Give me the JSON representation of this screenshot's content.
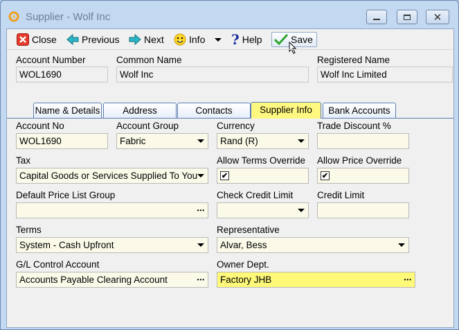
{
  "window": {
    "title": "Supplier - Wolf Inc"
  },
  "toolbar": {
    "close_label": "Close",
    "previous_label": "Previous",
    "next_label": "Next",
    "info_label": "Info",
    "help_label": "Help",
    "save_label": "Save"
  },
  "header": {
    "account_number_label": "Account Number",
    "account_number": "WOL1690",
    "common_name_label": "Common Name",
    "common_name": "Wolf Inc",
    "registered_name_label": "Registered Name",
    "registered_name": "Wolf Inc Limited"
  },
  "tabs": [
    "Name & Details",
    "Address",
    "Contacts",
    "Supplier Info",
    "Bank Accounts"
  ],
  "active_tab": "Supplier Info",
  "form": {
    "account_no_label": "Account No",
    "account_no": "WOL1690",
    "account_group_label": "Account Group",
    "account_group": "Fabric",
    "currency_label": "Currency",
    "currency": "Rand (R)",
    "trade_discount_label": "Trade Discount %",
    "trade_discount": "",
    "tax_label": "Tax",
    "tax": "Capital Goods or Services Supplied To You",
    "allow_terms_override_label": "Allow Terms Override",
    "allow_terms_override": true,
    "allow_price_override_label": "Allow Price Override",
    "allow_price_override": true,
    "default_price_list_group_label": "Default Price List Group",
    "default_price_list_group": "",
    "check_credit_limit_label": "Check Credit Limit",
    "check_credit_limit": "",
    "credit_limit_label": "Credit Limit",
    "credit_limit": "",
    "terms_label": "Terms",
    "terms": "System - Cash Upfront",
    "representative_label": "Representative",
    "representative": "Alvar, Bess",
    "gl_control_account_label": "G/L Control Account",
    "gl_control_account": "Accounts Payable Clearing Account",
    "owner_dept_label": "Owner Dept.",
    "owner_dept": "Factory JHB"
  },
  "glyphs": {
    "ellipsis": "•••",
    "check": "✔"
  },
  "colors": {
    "field_bg": "#fbf9e8",
    "highlight": "#fff97a",
    "window_bg": "#c3d8f1"
  }
}
